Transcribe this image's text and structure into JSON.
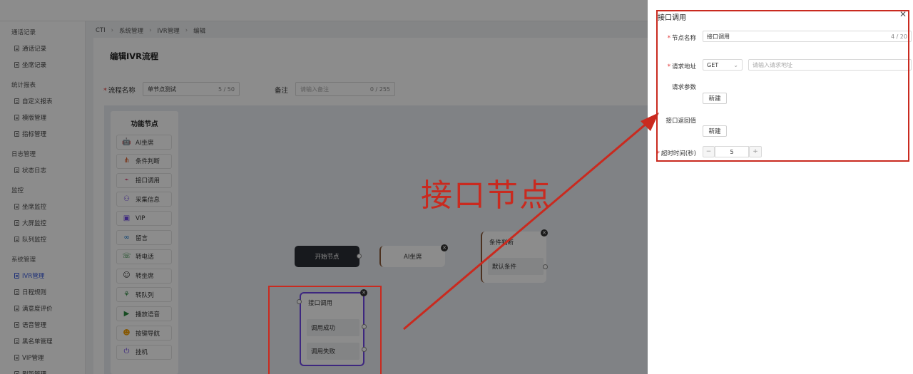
{
  "breadcrumb": [
    "CTI",
    "系统管理",
    "IVR管理",
    "编辑"
  ],
  "sidebar": {
    "groups": [
      {
        "label": "通话记录",
        "items": [
          "通话记录",
          "坐席记录"
        ]
      },
      {
        "label": "统计报表",
        "items": [
          "自定义报表",
          "模版管理",
          "指标管理"
        ]
      },
      {
        "label": "日志管理",
        "items": [
          "状态日志"
        ]
      },
      {
        "label": "监控",
        "items": [
          "坐席监控",
          "大屏监控",
          "队列监控"
        ]
      },
      {
        "label": "系统管理",
        "items": [
          "IVR管理",
          "日程规则",
          "满意度评价",
          "语音管理",
          "黑名单管理",
          "VIP管理",
          "刷新管理"
        ]
      }
    ],
    "active_item": "IVR管理"
  },
  "page": {
    "title": "编辑IVR流程",
    "flow_name_label": "流程名称",
    "flow_name_value": "单节点测试",
    "flow_name_count": "5 / 50",
    "remark_label": "备注",
    "remark_placeholder": "请输入备注",
    "remark_count": "0 / 255"
  },
  "palette": {
    "title": "功能节点",
    "items": [
      {
        "label": "AI坐席",
        "icon": "robot-icon"
      },
      {
        "label": "条件判断",
        "icon": "branch-icon"
      },
      {
        "label": "接口调用",
        "icon": "plug-icon"
      },
      {
        "label": "采集信息",
        "icon": "collect-icon"
      },
      {
        "label": "VIP",
        "icon": "vip-tv-icon"
      },
      {
        "label": "留言",
        "icon": "voicemail-icon"
      },
      {
        "label": "转电话",
        "icon": "phone-icon"
      },
      {
        "label": "转坐席",
        "icon": "agents-icon"
      },
      {
        "label": "转队列",
        "icon": "queue-icon"
      },
      {
        "label": "播放语音",
        "icon": "play-icon"
      },
      {
        "label": "按键导航",
        "icon": "keypad-icon"
      },
      {
        "label": "挂机",
        "icon": "power-icon"
      }
    ]
  },
  "canvas": {
    "start_node": "开始节点",
    "ai_node": "AI坐席",
    "condition_node": {
      "title": "条件判断",
      "default": "默认条件"
    },
    "api_node": {
      "title": "接口调用",
      "success": "调用成功",
      "fail": "调用失败"
    }
  },
  "drawer": {
    "title": "接口调用",
    "node_name_label": "节点名称",
    "node_name_value": "接口调用",
    "node_name_count": "4 / 20",
    "url_label": "请求地址",
    "method": "GET",
    "url_placeholder": "请输入请求地址",
    "params_label": "请求参数",
    "params_add": "新建",
    "return_label": "接口返回值",
    "return_add": "新建",
    "timeout_label": "超时时间(秒)",
    "timeout_value": "5",
    "minus": "−",
    "plus": "+"
  },
  "annotation": {
    "label": "接口节点",
    "color": "#c92a1f"
  }
}
